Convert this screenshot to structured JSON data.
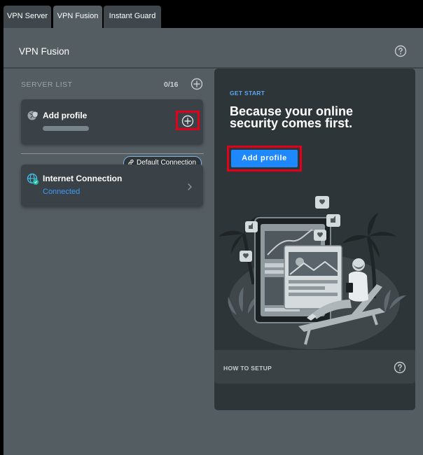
{
  "tabs": [
    {
      "label": "VPN Server",
      "active": false
    },
    {
      "label": "VPN Fusion",
      "active": true
    },
    {
      "label": "Instant Guard",
      "active": false
    }
  ],
  "page": {
    "title": "VPN Fusion",
    "help_icon": "question-circle-icon"
  },
  "server_list": {
    "label": "SERVER LIST",
    "count": "0/16",
    "add_icon": "plus-circle-icon"
  },
  "profile_card": {
    "title": "Add profile",
    "icon": "globe-shield-icon",
    "add_icon": "plus-circle-icon",
    "highlight_color": "#e3001b"
  },
  "default_badge": {
    "label": "Default Connection",
    "icon": "link-icon"
  },
  "internet_card": {
    "title": "Internet Connection",
    "status": "Connected",
    "status_color": "#3d9bff",
    "icon": "globe-icon",
    "chevron_icon": "chevron-right-icon"
  },
  "promo": {
    "kicker": "GET START",
    "headline": "Because your online security comes first.",
    "button_label": "Add profile",
    "button_color": "#1e88ff",
    "footer_label": "HOW TO SETUP",
    "footer_icon": "question-circle-icon"
  }
}
